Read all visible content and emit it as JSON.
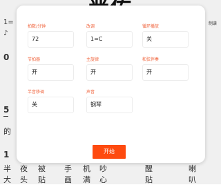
{
  "score": {
    "title": "晋佑",
    "key": "1=",
    "note_glyph": "♪",
    "right_tag": "制谱",
    "m1": "0",
    "m2": "5",
    "de": "的",
    "m3": "1",
    "lyrics_row1": [
      "半",
      "夜",
      "被",
      "手",
      "机",
      "吵",
      "醒",
      "喇"
    ],
    "lyrics_row2": [
      "大",
      "头",
      "贴",
      "画",
      "满",
      "心",
      "贴",
      "叭"
    ]
  },
  "dialog": {
    "fields": [
      {
        "label": "拍数/分钟",
        "value": "72"
      },
      {
        "label": "改调",
        "value": "1=C"
      },
      {
        "label": "循环播放",
        "value": "关"
      },
      {
        "label": "节拍器",
        "value": "开"
      },
      {
        "label": "主旋律",
        "value": "开"
      },
      {
        "label": "和弦伴奏",
        "value": "开"
      },
      {
        "label": "半音移调",
        "value": "关"
      },
      {
        "label": "声音",
        "value": "钢琴"
      }
    ],
    "start_label": "开始"
  }
}
